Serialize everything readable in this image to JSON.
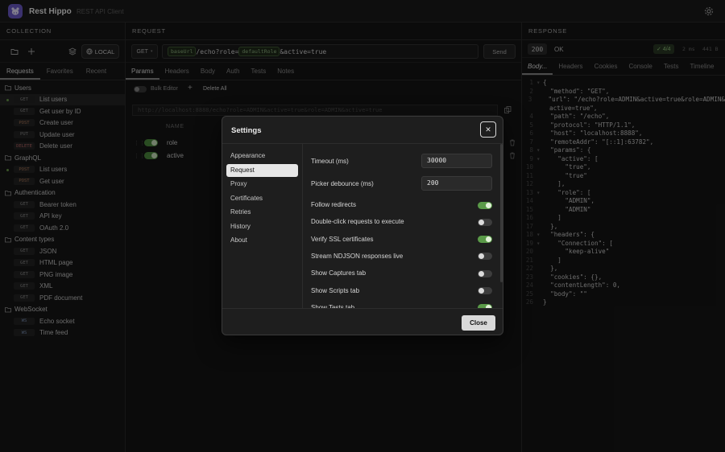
{
  "app": {
    "title": "Rest Hippo",
    "subtitle": "REST API Client"
  },
  "collection": {
    "heading": "COLLECTION",
    "env_label": "LOCAL",
    "tabs": [
      "Requests",
      "Favorites",
      "Recent"
    ],
    "tree": [
      {
        "type": "folder",
        "name": "Users"
      },
      {
        "type": "req",
        "method": "GET",
        "name": "List users",
        "selected": true
      },
      {
        "type": "req",
        "method": "GET",
        "name": "Get user by ID"
      },
      {
        "type": "req",
        "method": "POST",
        "name": "Create user"
      },
      {
        "type": "req",
        "method": "PUT",
        "name": "Update user"
      },
      {
        "type": "req",
        "method": "DELETE",
        "name": "Delete user"
      },
      {
        "type": "folder",
        "name": "GraphQL"
      },
      {
        "type": "req",
        "method": "POST",
        "name": "List users",
        "dot": true
      },
      {
        "type": "req",
        "method": "POST",
        "name": "Get user"
      },
      {
        "type": "folder",
        "name": "Authentication"
      },
      {
        "type": "req",
        "method": "GET",
        "name": "Bearer token"
      },
      {
        "type": "req",
        "method": "GET",
        "name": "API key"
      },
      {
        "type": "req",
        "method": "GET",
        "name": "OAuth 2.0"
      },
      {
        "type": "folder",
        "name": "Content types"
      },
      {
        "type": "req",
        "method": "GET",
        "name": "JSON"
      },
      {
        "type": "req",
        "method": "GET",
        "name": "HTML page"
      },
      {
        "type": "req",
        "method": "GET",
        "name": "PNG image"
      },
      {
        "type": "req",
        "method": "GET",
        "name": "XML"
      },
      {
        "type": "req",
        "method": "GET",
        "name": "PDF document"
      },
      {
        "type": "folder",
        "name": "WebSocket"
      },
      {
        "type": "req",
        "method": "WS",
        "name": "Echo socket"
      },
      {
        "type": "req",
        "method": "WS",
        "name": "Time feed"
      }
    ]
  },
  "request": {
    "heading": "REQUEST",
    "method": "GET",
    "url_var1": "baseUrl",
    "url_mid": "/echo?role=",
    "url_var2": "defaultRole",
    "url_tail": "&active=true",
    "send_label": "Send",
    "tabs": [
      "Params",
      "Headers",
      "Body",
      "Auth",
      "Tests",
      "Notes"
    ],
    "bulk_editor_label": "Bulk Editor",
    "delete_all_label": "Delete All",
    "preview_url": "http://localhost:8888/echo?role=ADMIN&active=true&role=ADMIN&active=true",
    "param_header": "NAME",
    "params": [
      "role",
      "active"
    ]
  },
  "response": {
    "heading": "RESPONSE",
    "status_code": "200",
    "status_text": "OK",
    "tests": "✓ 4/4",
    "time": "2 ms",
    "size": "441 B",
    "tabs": [
      "Body...",
      "Headers",
      "Cookies",
      "Console",
      "Tests",
      "Timeline"
    ],
    "body_lines": [
      {
        "n": "1",
        "f": "▾",
        "t": "{"
      },
      {
        "n": "2",
        "f": "",
        "t": "  \"method\": \"GET\","
      },
      {
        "n": "3",
        "f": "",
        "t": "  \"url\": \"/echo?role=ADMIN&active=true&role=ADMIN&"
      },
      {
        "n": "",
        "f": "",
        "t": "active=true\","
      },
      {
        "n": "4",
        "f": "",
        "t": "  \"path\": \"/echo\","
      },
      {
        "n": "5",
        "f": "",
        "t": "  \"protocol\": \"HTTP/1.1\","
      },
      {
        "n": "6",
        "f": "",
        "t": "  \"host\": \"localhost:8888\","
      },
      {
        "n": "7",
        "f": "",
        "t": "  \"remoteAddr\": \"[::1]:63782\","
      },
      {
        "n": "8",
        "f": "▾",
        "t": "  \"params\": {"
      },
      {
        "n": "9",
        "f": "▾",
        "t": "    \"active\": ["
      },
      {
        "n": "10",
        "f": "",
        "t": "      \"true\","
      },
      {
        "n": "11",
        "f": "",
        "t": "      \"true\""
      },
      {
        "n": "12",
        "f": "",
        "t": "    ],"
      },
      {
        "n": "13",
        "f": "▾",
        "t": "    \"role\": ["
      },
      {
        "n": "14",
        "f": "",
        "t": "      \"ADMIN\","
      },
      {
        "n": "15",
        "f": "",
        "t": "      \"ADMIN\""
      },
      {
        "n": "16",
        "f": "",
        "t": "    ]"
      },
      {
        "n": "17",
        "f": "",
        "t": "  },"
      },
      {
        "n": "18",
        "f": "▾",
        "t": "  \"headers\": {"
      },
      {
        "n": "19",
        "f": "▾",
        "t": "    \"Connection\": ["
      },
      {
        "n": "20",
        "f": "",
        "t": "      \"keep-alive\""
      },
      {
        "n": "21",
        "f": "",
        "t": "    ]"
      },
      {
        "n": "22",
        "f": "",
        "t": "  },"
      },
      {
        "n": "23",
        "f": "",
        "t": "  \"cookies\": {},"
      },
      {
        "n": "24",
        "f": "",
        "t": "  \"contentLength\": 0,"
      },
      {
        "n": "25",
        "f": "",
        "t": "  \"body\": \"\""
      },
      {
        "n": "26",
        "f": "",
        "t": "}"
      }
    ]
  },
  "settings": {
    "title": "Settings",
    "nav": [
      "Appearance",
      "Request",
      "Proxy",
      "Certificates",
      "Retries",
      "History",
      "About"
    ],
    "active_nav": "Request",
    "timeout_label": "Timeout (ms)",
    "timeout_value": "30000",
    "debounce_label": "Picker debounce (ms)",
    "debounce_value": "200",
    "toggles": [
      {
        "label": "Follow redirects",
        "on": true
      },
      {
        "label": "Double-click requests to execute",
        "on": false
      },
      {
        "label": "Verify SSL certificates",
        "on": true
      },
      {
        "label": "Stream NDJSON responses live",
        "on": false
      },
      {
        "label": "Show Captures tab",
        "on": false
      },
      {
        "label": "Show Scripts tab",
        "on": false
      },
      {
        "label": "Show Tests tab",
        "on": true
      }
    ],
    "close_label": "Close"
  }
}
